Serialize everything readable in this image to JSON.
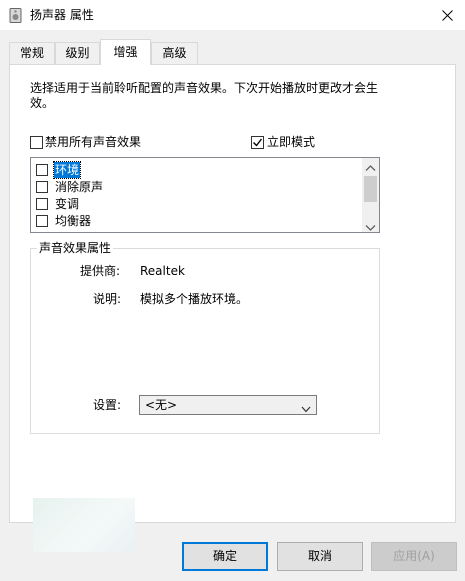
{
  "window": {
    "title": "扬声器 属性",
    "close_glyph": "✕"
  },
  "tabs": [
    {
      "label": "常规"
    },
    {
      "label": "级别"
    },
    {
      "label": "增强"
    },
    {
      "label": "高级"
    }
  ],
  "description": "选择适用于当前聆听配置的声音效果。下次开始播放时更改才会生效。",
  "disable_all": {
    "label": "禁用所有声音效果",
    "checked": false
  },
  "immediate_mode": {
    "label": "立即模式",
    "checked": true
  },
  "effects": [
    {
      "label": "环境",
      "checked": false,
      "selected": true
    },
    {
      "label": "消除原声",
      "checked": false,
      "selected": false
    },
    {
      "label": "变调",
      "checked": false,
      "selected": false
    },
    {
      "label": "均衡器",
      "checked": false,
      "selected": false
    }
  ],
  "properties": {
    "title": "声音效果属性",
    "provider_label": "提供商:",
    "provider_value": "Realtek",
    "description_label": "说明:",
    "description_value": "模拟多个播放环境。",
    "settings_label": "设置:",
    "settings_value": "<无>"
  },
  "buttons": {
    "ok": "确定",
    "cancel": "取消",
    "apply": "应用(A)"
  },
  "colors": {
    "accent": "#0078d7",
    "disabled_text": "#a0a0a0"
  }
}
